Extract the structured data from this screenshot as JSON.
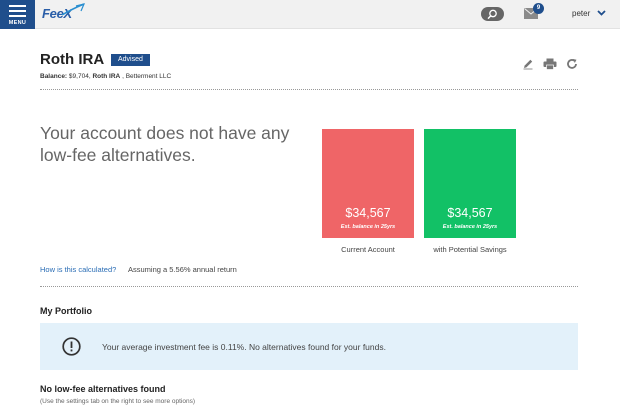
{
  "header": {
    "menu_label": "MENU",
    "logo_text": "FeeX",
    "mail_count": "9",
    "username": "peter"
  },
  "account": {
    "title": "Roth IRA",
    "badge": "Advised",
    "balance_label": "Balance:",
    "balance_value": "$9,704",
    "separator1": ",",
    "account_type": "Roth IRA",
    "separator2": ",",
    "provider": "Betterment LLC"
  },
  "summary": {
    "headline": "Your account does not have any low-fee alternatives.",
    "cards": [
      {
        "amount": "$34,567",
        "subtitle": "Est. balance in 25yrs",
        "caption": "Current Account"
      },
      {
        "amount": "$34,567",
        "subtitle": "Est. balance in 25yrs",
        "caption": "with Potential Savings"
      }
    ],
    "calc_link": "How is this calculated?",
    "calc_note": "Assuming a 5.56% annual return"
  },
  "portfolio": {
    "title": "My Portfolio",
    "info_text": "Your average investment fee is 0.11%. No alternatives found for your funds."
  },
  "no_alternatives": {
    "title": "No low-fee alternatives found",
    "subtitle": "(Use the settings tab on the right to see more options)"
  },
  "colors": {
    "brand": "#1f4e8c",
    "current_card": "#ef6567",
    "savings_card": "#12c166",
    "info_bg": "#e3f1fa",
    "link": "#2a6db5"
  },
  "icons": [
    "menu-icon",
    "search-icon",
    "mail-icon",
    "chevron-down-icon",
    "edit-icon",
    "print-icon",
    "refresh-icon",
    "info-icon"
  ]
}
